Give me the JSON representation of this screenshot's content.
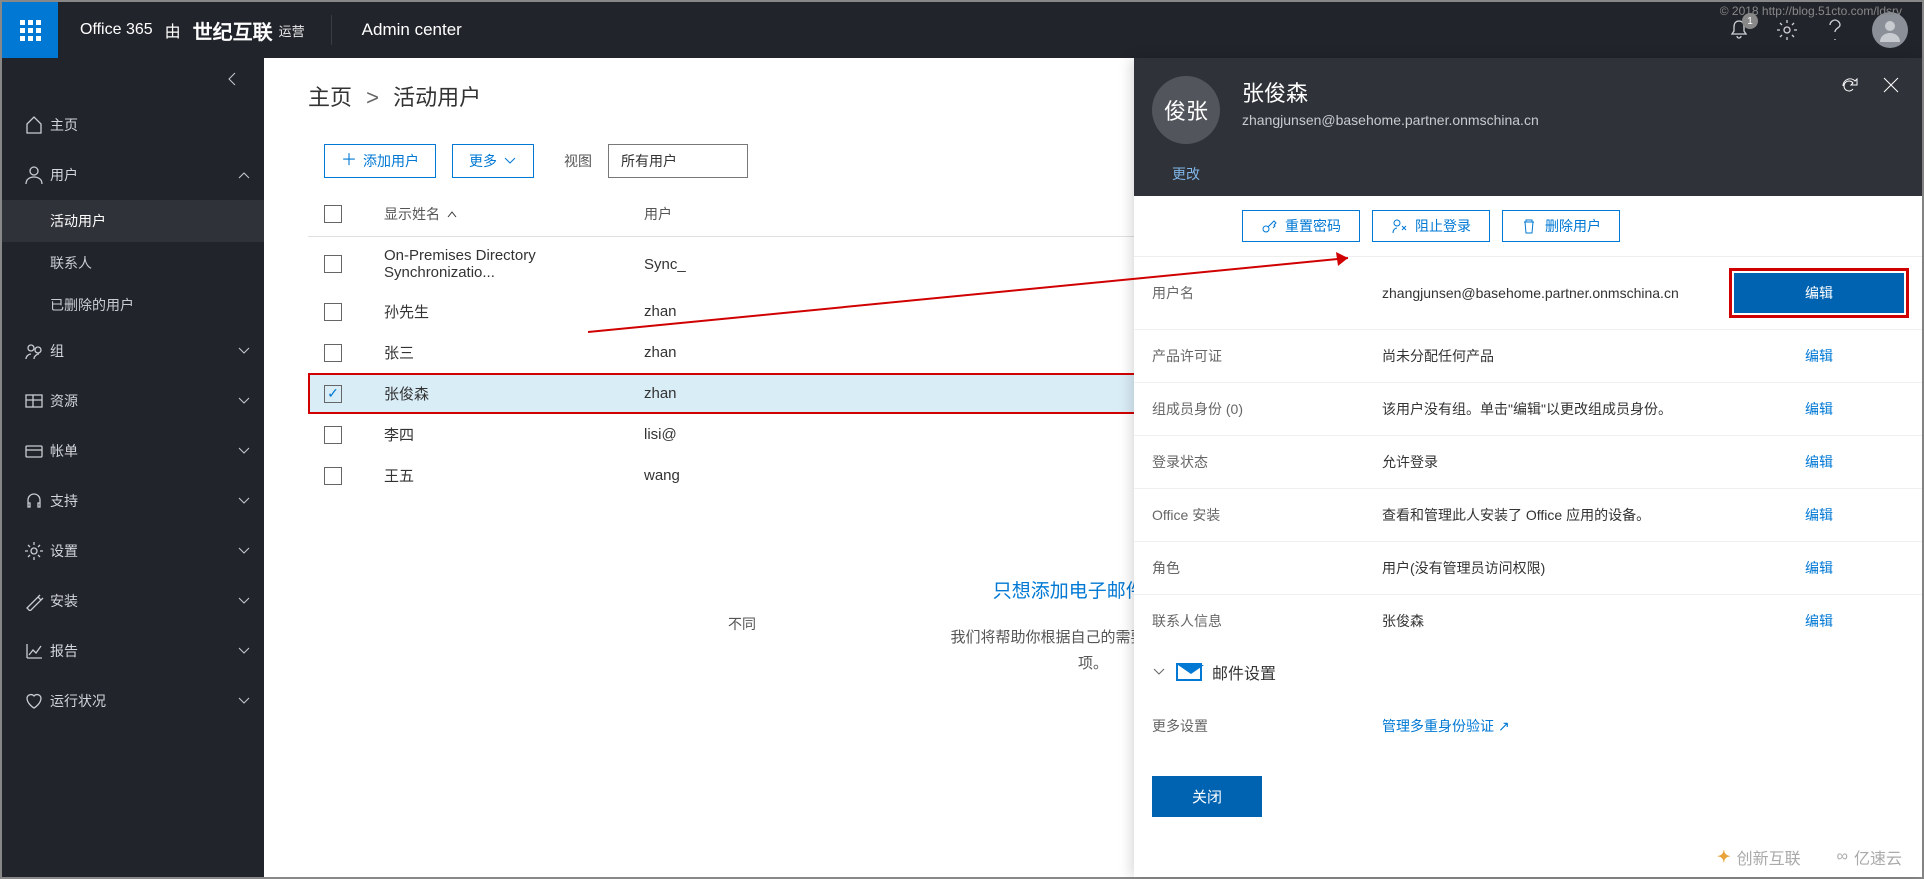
{
  "watermark_top": "© 2018 http://blog.51cto.com/ldsrv",
  "watermark_bottom_left": "创新互联",
  "watermark_bottom_right": "亿速云",
  "topbar": {
    "brand_o365": "Office 365",
    "brand_by": "由",
    "brand_vendor": "世纪互联",
    "brand_op": "运营",
    "admin_center": "Admin center",
    "notif_count": "1"
  },
  "sidebar": {
    "home": "主页",
    "users": "用户",
    "users_sub": {
      "active": "活动用户",
      "contacts": "联系人",
      "deleted": "已删除的用户"
    },
    "groups": "组",
    "resources": "资源",
    "billing": "帐单",
    "support": "支持",
    "settings": "设置",
    "setup": "安装",
    "reports": "报告",
    "health": "运行状况"
  },
  "breadcrumb": {
    "home": "主页",
    "current": "活动用户"
  },
  "toolbar": {
    "add_user": "添加用户",
    "more": "更多",
    "view_label": "视图",
    "view_value": "所有用户"
  },
  "table": {
    "head_name": "显示姓名",
    "head_user": "用户",
    "rows": [
      {
        "checked": false,
        "name": "On-Premises Directory Synchronizatio...",
        "user": "Sync_"
      },
      {
        "checked": false,
        "name": "孙先生",
        "user": "zhan"
      },
      {
        "checked": false,
        "name": "张三",
        "user": "zhan"
      },
      {
        "checked": true,
        "name": "张俊森",
        "user": "zhan"
      },
      {
        "checked": false,
        "name": "李四",
        "user": "lisi@"
      },
      {
        "checked": false,
        "name": "王五",
        "user": "wang"
      }
    ]
  },
  "promo": {
    "title": "只想添加电子邮件地址?",
    "line1": "我们将帮助你根据自己的需要选择适当的选",
    "line2": "项。",
    "side": "不同"
  },
  "detail": {
    "avatar_initials": "俊张",
    "name": "张俊森",
    "email": "zhangjunsen@basehome.partner.onmschina.cn",
    "change": "更改",
    "actions": {
      "reset": "重置密码",
      "block": "阻止登录",
      "delete": "删除用户"
    },
    "rows": [
      {
        "label": "用户名",
        "value": "zhangjunsen@basehome.partner.onmschina.cn",
        "edit": "编辑",
        "highlight": true
      },
      {
        "label": "产品许可证",
        "value": "尚未分配任何产品",
        "edit": "编辑"
      },
      {
        "label": "组成员身份 (0)",
        "value": "该用户没有组。单击\"编辑\"以更改组成员身份。",
        "edit": "编辑"
      },
      {
        "label": "登录状态",
        "value": "允许登录",
        "edit": "编辑"
      },
      {
        "label": "Office 安装",
        "value": "查看和管理此人安装了 Office 应用的设备。",
        "edit": "编辑"
      },
      {
        "label": "角色",
        "value": "用户(没有管理员访问权限)",
        "edit": "编辑"
      },
      {
        "label": "联系人信息",
        "value": "张俊森",
        "edit": "编辑"
      }
    ],
    "mail_section": "邮件设置",
    "more_settings_label": "更多设置",
    "more_settings_link": "管理多重身份验证",
    "close": "关闭"
  }
}
